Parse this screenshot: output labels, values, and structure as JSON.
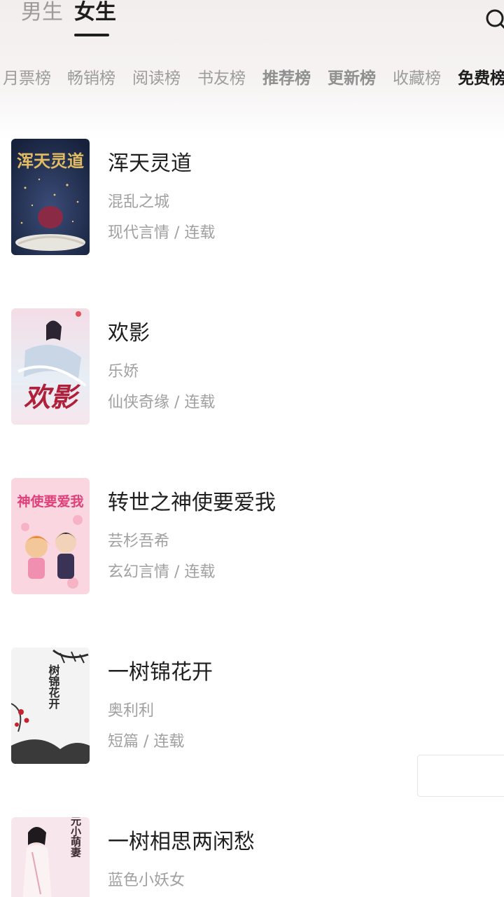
{
  "gender_tabs": [
    {
      "label": "男生"
    },
    {
      "label": "女生"
    }
  ],
  "rank_tabs": [
    {
      "label": "月票榜"
    },
    {
      "label": "畅销榜"
    },
    {
      "label": "阅读榜"
    },
    {
      "label": "书友榜"
    },
    {
      "label": "推荐榜"
    },
    {
      "label": "更新榜"
    },
    {
      "label": "收藏榜"
    },
    {
      "label": "免费榜"
    }
  ],
  "books": [
    {
      "title": "浑天灵道",
      "author": "混乱之城",
      "meta": "现代言情 / 连载",
      "cover_text": "浑天灵道",
      "cover_colors": [
        "#1f2c4a",
        "#d9b25a"
      ]
    },
    {
      "title": "欢影",
      "author": "乐娇",
      "meta": "仙侠奇缘 / 连载",
      "cover_text": "欢影",
      "cover_colors": [
        "#f3d9e2",
        "#b0203a"
      ]
    },
    {
      "title": "转世之神使要爱我",
      "author": "芸杉吾希",
      "meta": "玄幻言情 / 连载",
      "cover_text": "神使要爱我",
      "cover_colors": [
        "#f9d3de",
        "#e0407a"
      ]
    },
    {
      "title": "一树锦花开",
      "author": "奥利利",
      "meta": "短篇 / 连载",
      "cover_text": "树锦花开",
      "cover_colors": [
        "#f4f4f4",
        "#2a2a2a"
      ]
    },
    {
      "title": "一树相思两闲愁",
      "author": "蓝色小妖女",
      "meta": "",
      "cover_text": "状元小萌妻",
      "cover_colors": [
        "#f7e4ea",
        "#3a2a30"
      ]
    }
  ],
  "colors": {
    "accent": "#1e1e1e",
    "muted": "#a0a0a0"
  },
  "icons": {
    "search": "search-icon"
  }
}
